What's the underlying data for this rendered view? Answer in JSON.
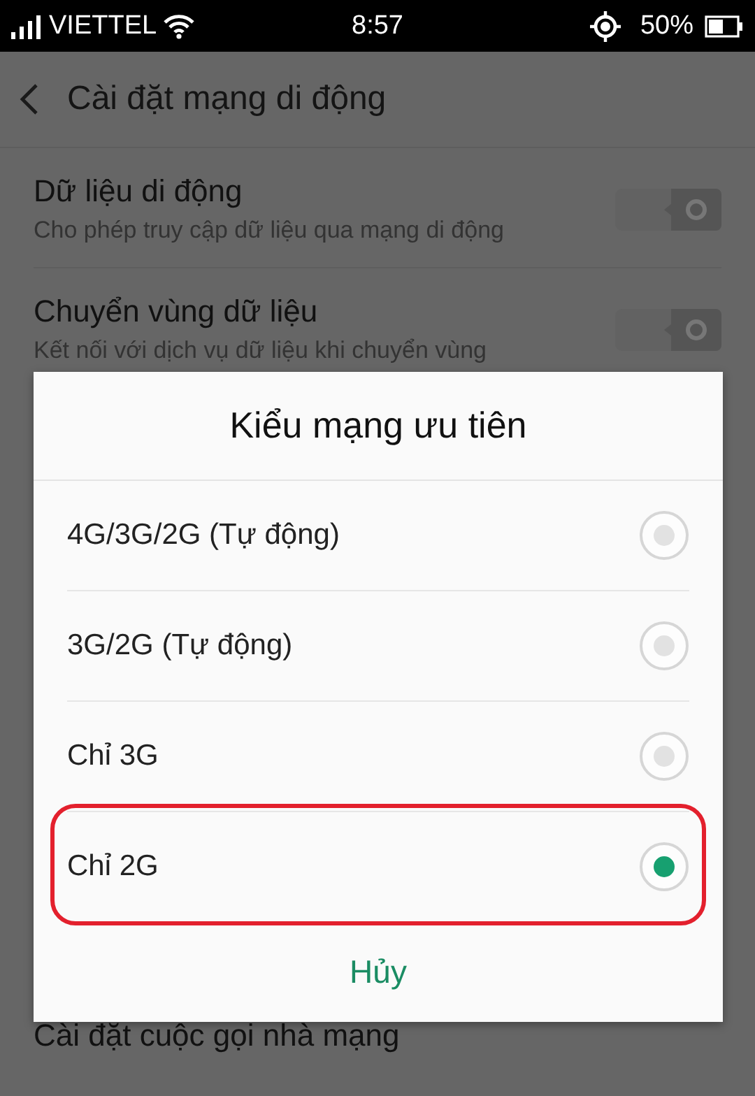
{
  "status_bar": {
    "carrier": "VIETTEL",
    "time": "8:57",
    "battery": "50%"
  },
  "header": {
    "title": "Cài đặt mạng di động"
  },
  "settings": [
    {
      "title": "Dữ liệu di động",
      "subtitle": "Cho phép truy cập dữ liệu qua mạng di động",
      "on": false
    },
    {
      "title": "Chuyển vùng dữ liệu",
      "subtitle": "Kết nối với dịch vụ dữ liệu khi chuyển vùng",
      "on": false
    },
    {
      "title": "Cài đặt cuộc gọi nhà mạng"
    }
  ],
  "dialog": {
    "title": "Kiểu mạng ưu tiên",
    "options": [
      {
        "label": "4G/3G/2G (Tự động)",
        "selected": false,
        "highlighted": false
      },
      {
        "label": "3G/2G (Tự động)",
        "selected": false,
        "highlighted": false
      },
      {
        "label": "Chỉ 3G",
        "selected": false,
        "highlighted": false
      },
      {
        "label": "Chỉ 2G",
        "selected": true,
        "highlighted": true
      }
    ],
    "cancel": "Hủy"
  }
}
